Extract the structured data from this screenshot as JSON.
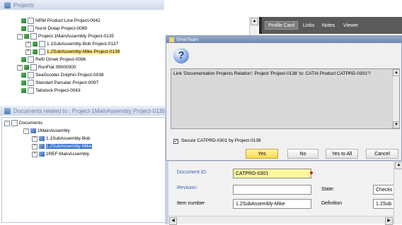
{
  "projects_panel": {
    "title": "Projects",
    "items": [
      {
        "label": "NRM Product Line Project-0042"
      },
      {
        "label": "Nurol Dolap Project-0089"
      },
      {
        "label": "Project-1MainAssembly Project-0135"
      },
      {
        "label": "1.1SubAssembly-Bob Project-0137"
      },
      {
        "label": "1.2SubAssembly-Mike Project-0138"
      },
      {
        "label": "Refil Ornek Project-0096"
      },
      {
        "label": "RunFlat 09000000"
      },
      {
        "label": "SeaScooter Dolphin Project-0038"
      },
      {
        "label": "Standart Parcalar Project-0097"
      },
      {
        "label": "Tailstock Project-0043"
      }
    ]
  },
  "documents_panel": {
    "title": "Documents related to : Project-1MainAssembly Project-0135",
    "items": [
      {
        "label": "Documents"
      },
      {
        "label": "1MainAssembly"
      },
      {
        "label": "1.1SubAssembly-Bob"
      },
      {
        "label": "1.2SubAssembly-Mike"
      },
      {
        "label": "1REF-MainAssembly"
      }
    ]
  },
  "tabs": [
    "Profile Card",
    "Links",
    "Notes",
    "Viewer"
  ],
  "dialog": {
    "title": "SmarTeam",
    "message": "Link 'Documentation Projects Relation': Project 'Project-0138' to: CATIA Product CATPRD-0301'?",
    "checkbox_label": "Secure CATPRD-0301 by Project-0138",
    "checkbox_checked": true,
    "buttons": {
      "yes": "Yes",
      "no": "No",
      "yes_to_all": "Yes to All",
      "cancel": "Cancel"
    }
  },
  "profile_card": {
    "document_id_label": "Document ID:",
    "document_id_value": "CATPRD-0301",
    "revision_label": "Revision:",
    "revision_value": "",
    "item_number_label": "Item number",
    "item_number_value": "1.2SubAssembly-Mike",
    "state_label": "State:",
    "state_value": "Checks",
    "definition_label": "Definition",
    "definition_value": "1.2Sub"
  },
  "colors": {
    "selection": "#ffe98a",
    "accent_red": "#d81e1e",
    "link_blue": "#3a5db8"
  }
}
